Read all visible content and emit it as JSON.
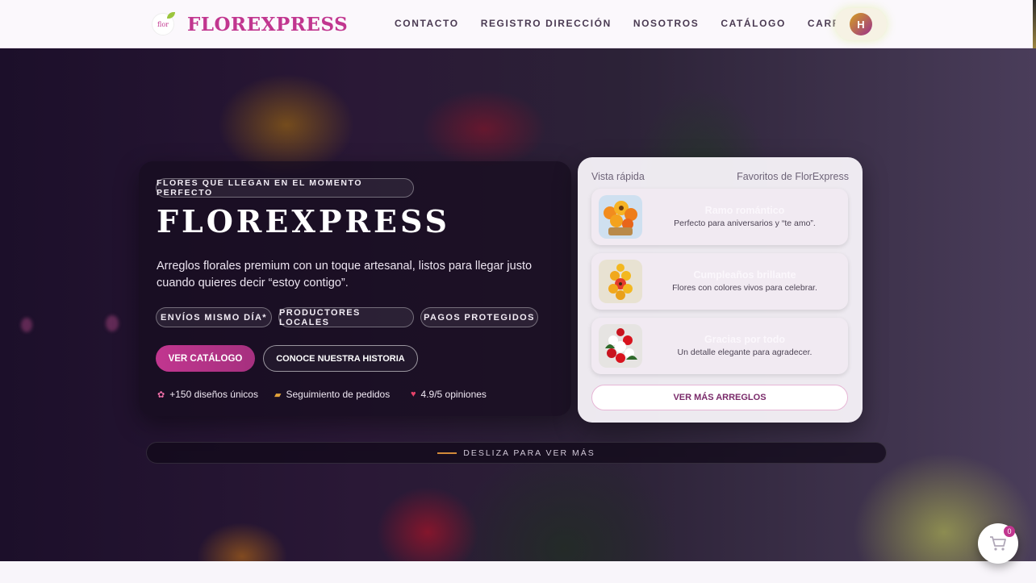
{
  "brand": {
    "name": "FLOREXPRESS",
    "logo_text": "flor"
  },
  "nav": {
    "links": [
      "CONTACTO",
      "REGISTRO DIRECCIÓN",
      "NOSOTROS",
      "CATÁLOGO",
      "CARRITO"
    ],
    "avatar_initial": "H"
  },
  "hero": {
    "eyebrow": "FLORES QUE LLEGAN EN EL MOMENTO PERFECTO",
    "title": "FLOREXPRESS",
    "description": "Arreglos florales premium con un toque artesanal, listos para llegar justo cuando quieres decir “estoy contigo”.",
    "tags": [
      "ENVÍOS MISMO DÍA*",
      "PRODUCTORES LOCALES",
      "PAGOS PROTEGIDOS"
    ],
    "primary_button": "VER CATÁLOGO",
    "secondary_button": "CONOCE NUESTRA HISTORIA",
    "stats": [
      {
        "icon": "flower-icon",
        "text": "+150 diseños únicos"
      },
      {
        "icon": "truck-icon",
        "text": "Seguimiento de pedidos"
      },
      {
        "icon": "heart-icon",
        "text": "4.9/5 opiniones"
      }
    ]
  },
  "quick_view": {
    "label_left": "Vista rápida",
    "label_right": "Favoritos de FlorExpress",
    "items": [
      {
        "title": "Ramo romántico",
        "subtitle": "Perfecto para aniversarios y “te amo”."
      },
      {
        "title": "Cumpleaños brillante",
        "subtitle": "Flores con colores vivos para celebrar."
      },
      {
        "title": "Gracias por todo",
        "subtitle": "Un detalle elegante para agradecer."
      }
    ],
    "more_button": "VER MÁS ARREGLOS"
  },
  "scroll_hint": "DESLIZA PARA VER MÁS",
  "cart": {
    "count": "0"
  },
  "colors": {
    "accent": "#c1368f",
    "dark": "#1c0f2a"
  }
}
